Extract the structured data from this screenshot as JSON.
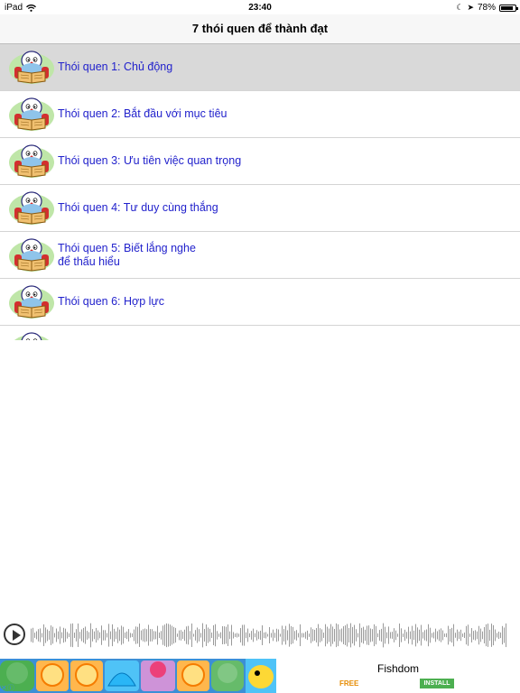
{
  "status": {
    "device": "iPad",
    "time": "23:40",
    "battery": "78%",
    "battery_level": 0.78
  },
  "nav": {
    "title": "7 thói quen để thành đạt"
  },
  "list": {
    "items": [
      {
        "label": "Thói quen 1: Chủ động"
      },
      {
        "label": "Thói quen 2: Bắt đầu với mục tiêu"
      },
      {
        "label": "Thói quen 3: Ưu tiên việc quan trọng"
      },
      {
        "label": "Thói quen 4: Tư duy cùng thắng"
      },
      {
        "label": "Thói quen 5: Biết lắng nghe\nđể thấu hiểu"
      },
      {
        "label": "Thói quen 6: Hợp lực"
      }
    ]
  },
  "ad": {
    "app_name": "Fishdom",
    "price": "FREE",
    "install": "INSTALL"
  },
  "colors": {
    "link": "#2222cc",
    "selected_row": "#d9d9d9",
    "install_green": "#4caf50",
    "free_orange": "#e68a00"
  }
}
